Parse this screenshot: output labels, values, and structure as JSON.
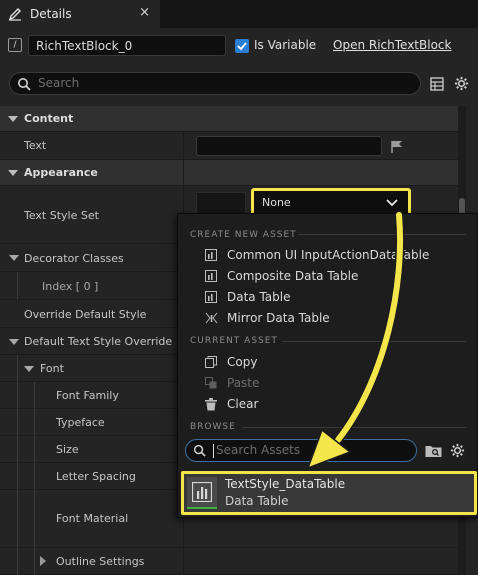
{
  "tab": {
    "title": "Details",
    "close": "×"
  },
  "header": {
    "name_value": "RichTextBlock_0",
    "is_variable_label": "Is Variable",
    "is_variable_checked": true,
    "open_link": "Open RichTextBlock"
  },
  "search": {
    "placeholder": "Search"
  },
  "sections": {
    "content": "Content",
    "appearance": "Appearance"
  },
  "rows": {
    "text": "Text",
    "text_style_set": "Text Style Set",
    "decorator_classes": "Decorator Classes",
    "index0": "Index [ 0 ]",
    "override_default_style": "Override Default Style",
    "default_text_style_override": "Default Text Style Override",
    "font": "Font",
    "font_family": "Font Family",
    "typeface": "Typeface",
    "size": "Size",
    "letter_spacing": "Letter Spacing",
    "font_material": "Font Material",
    "outline_settings": "Outline Settings"
  },
  "combo": {
    "value": "None"
  },
  "menu": {
    "create_header": "CREATE NEW ASSET",
    "create_items": [
      {
        "label": "Common UI InputActionDataTable",
        "icon": "table-icon"
      },
      {
        "label": "Composite Data Table",
        "icon": "table-icon"
      },
      {
        "label": "Data Table",
        "icon": "table-icon"
      },
      {
        "label": "Mirror Data Table",
        "icon": "mirror-table-icon"
      }
    ],
    "current_header": "CURRENT ASSET",
    "current_items": [
      {
        "label": "Copy",
        "icon": "copy-icon",
        "enabled": true
      },
      {
        "label": "Paste",
        "icon": "paste-icon",
        "enabled": false
      },
      {
        "label": "Clear",
        "icon": "trash-icon",
        "enabled": true
      }
    ],
    "browse_header": "BROWSE",
    "browse_search_placeholder": "Search Assets",
    "asset": {
      "name": "TextStyle_DataTable",
      "type": "Data Table"
    }
  },
  "colors": {
    "highlight": "#f4e54a",
    "checkbox": "#2a7fd4",
    "asset_underline": "#3fae3f"
  }
}
